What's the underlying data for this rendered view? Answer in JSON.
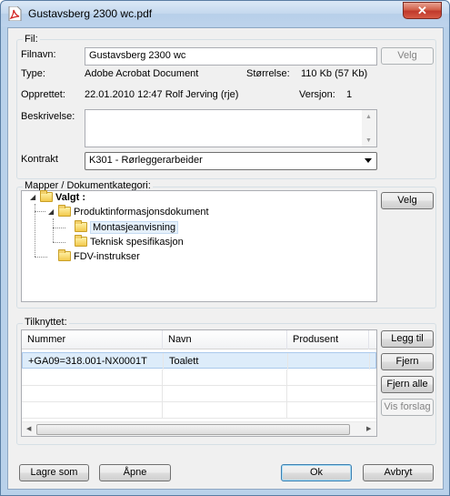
{
  "window": {
    "title": "Gustavsberg 2300 wc.pdf",
    "close_glyph": "✕",
    "icon": "pdf-file-icon"
  },
  "file": {
    "group_label": "Fil:",
    "filename_label": "Filnavn:",
    "filename_value": "Gustavsberg 2300 wc",
    "choose_button": "Velg",
    "type_label": "Type:",
    "type_value": "Adobe Acrobat Document",
    "size_label": "Størrelse:",
    "size_value": "110 Kb (57 Kb)",
    "created_label": "Opprettet:",
    "created_value": "22.01.2010 12:47 Rolf Jerving (rje)",
    "version_label": "Versjon:",
    "version_value": "1",
    "description_label": "Beskrivelse:",
    "description_value": "",
    "contract_label": "Kontrakt",
    "contract_value": "K301 - Rørleggerarbeider"
  },
  "folders": {
    "group_label": "Mapper / Dokumentkategori:",
    "choose_button": "Velg",
    "tree": [
      {
        "label": "Valgt :",
        "bold": true
      },
      {
        "label": "Produktinformasjonsdokument"
      },
      {
        "label": "Montasjeanvisning",
        "selected": true
      },
      {
        "label": "Teknisk spesifikasjon"
      },
      {
        "label": "FDV-instrukser"
      }
    ]
  },
  "linked": {
    "group_label": "Tilknyttet:",
    "columns": [
      "Nummer",
      "Navn",
      "Produsent"
    ],
    "rows": [
      [
        "+GA09=318.001-NX0001T",
        "Toalett",
        ""
      ]
    ],
    "add_button": "Legg til",
    "remove_button": "Fjern",
    "remove_all_button": "Fjern alle",
    "suggest_button": "Vis forslag"
  },
  "footer": {
    "save_as": "Lagre som",
    "open": "Åpne",
    "ok": "Ok",
    "cancel": "Avbryt"
  }
}
